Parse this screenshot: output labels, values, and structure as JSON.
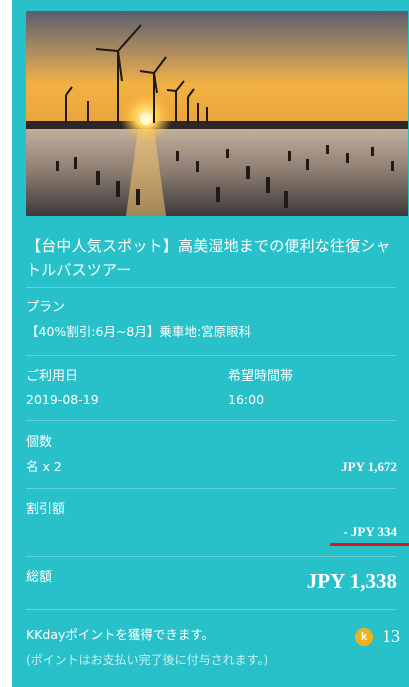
{
  "tour": {
    "image_alt": "windmills-sunset-tidal-flat",
    "title": "【台中人気スポット】高美湿地までの便利な往復シャトルバスツアー"
  },
  "plan": {
    "label": "プラン",
    "value": "【40%割引:6月~8月】乗車地:宮原眼科"
  },
  "date": {
    "label": "ご利用日",
    "value": "2019-08-19"
  },
  "time": {
    "label": "希望時間帯",
    "value": "16:00"
  },
  "quantity": {
    "label": "個数",
    "value": "名 x 2",
    "price": "JPY 1,672"
  },
  "discount": {
    "label": "割引額",
    "price": "- JPY 334",
    "underline_color": "#e0151b"
  },
  "total": {
    "label": "総額",
    "price": "JPY 1,338"
  },
  "points": {
    "label": "KKdayポイントを獲得できます。",
    "icon_letter": "k",
    "icon_name": "kkday-coin-icon",
    "amount": "13",
    "note": "(ポイントはお支払い完了後に付与されます。)"
  },
  "colors": {
    "card_bg": "#29c1c9",
    "text": "#ffffff",
    "coin": "#f2b21c"
  }
}
